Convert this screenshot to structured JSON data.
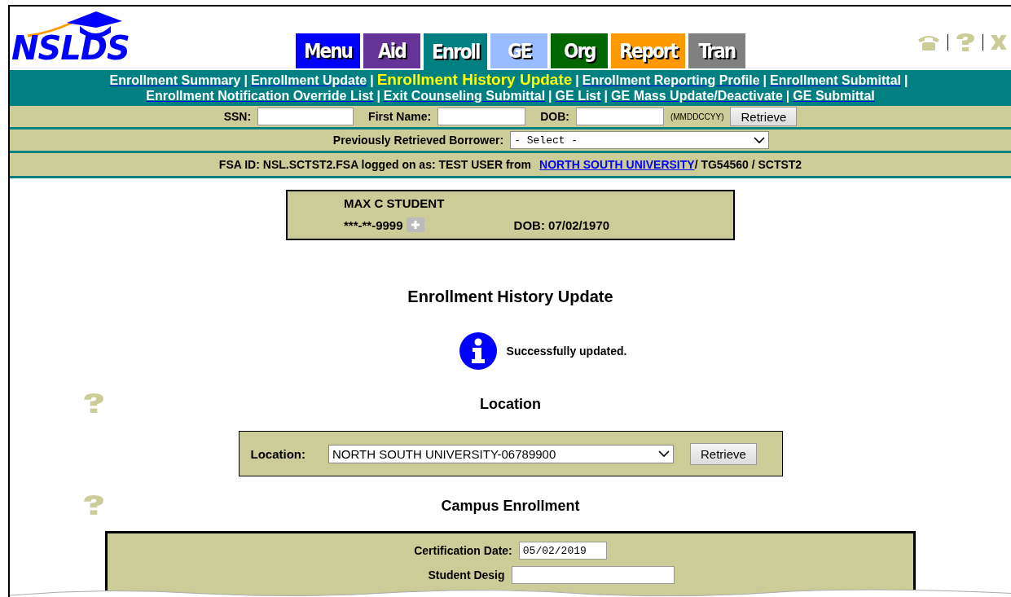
{
  "logo": {
    "text": "NSLDS"
  },
  "tabs": [
    {
      "label": "Menu",
      "color": "#0000ff",
      "selected": false
    },
    {
      "label": "Aid",
      "color": "#663399",
      "selected": false
    },
    {
      "label": "Enroll",
      "color": "#008080",
      "selected": true
    },
    {
      "label": "GE",
      "color": "#99bbff",
      "selected": false
    },
    {
      "label": "Org",
      "color": "#006600",
      "selected": false
    },
    {
      "label": "Report",
      "color": "#ff9900",
      "selected": false
    },
    {
      "label": "Tran",
      "color": "#808080",
      "selected": false
    }
  ],
  "nav_separator": "|",
  "nav_lines": [
    [
      {
        "label": "Enrollment Summary",
        "selected": false
      },
      {
        "label": "Enrollment Update",
        "selected": false
      },
      {
        "label": "Enrollment History Update",
        "selected": true
      },
      {
        "label": "Enrollment Reporting Profile",
        "selected": false
      },
      {
        "label": "Enrollment Submittal",
        "selected": false
      }
    ],
    [
      {
        "label": "Enrollment Notification Override List",
        "selected": false
      },
      {
        "label": "Exit Counseling Submittal",
        "selected": false
      },
      {
        "label": "GE List",
        "selected": false
      },
      {
        "label": "GE Mass Update/Deactivate",
        "selected": false
      },
      {
        "label": "GE Submittal",
        "selected": false
      }
    ]
  ],
  "search": {
    "ssn_label": "SSN:",
    "first_name_label": "First Name:",
    "dob_label": "DOB:",
    "dob_hint": "(MMDDCCYY)",
    "button": "Retrieve"
  },
  "previous": {
    "label": "Previously Retrieved Borrower:",
    "value": "- Select -"
  },
  "login": {
    "prefix": "FSA ID: NSL.SCTST2.FSA logged on as: TEST USER from",
    "school": "NORTH SOUTH UNIVERSITY ",
    "suffix": "/ TG54560 / SCTST2"
  },
  "student": {
    "name": "MAX C STUDENT",
    "ssn": "***-**-9999",
    "dob": "DOB: 07/02/1970"
  },
  "page_title": "Enrollment History Update",
  "message": "Successfully updated.",
  "location_section": {
    "title": "Location",
    "label": "Location:",
    "value": "NORTH SOUTH UNIVERSITY-06789900",
    "button": "Retrieve"
  },
  "campus_section": {
    "title": "Campus Enrollment",
    "fields": [
      {
        "label": "Certification Date:",
        "value": "05/02/2019"
      },
      {
        "label": "Student Desig"
      }
    ]
  }
}
